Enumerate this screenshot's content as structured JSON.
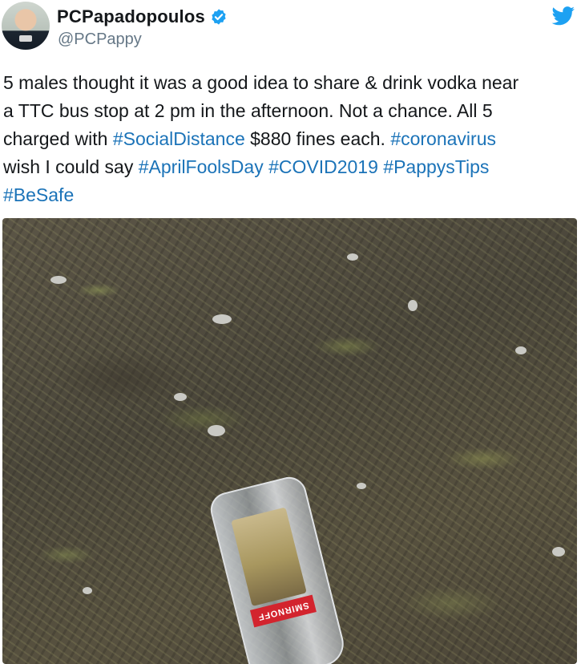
{
  "author": {
    "display_name": "PCPapadopoulos",
    "handle": "@PCPappy",
    "verified_icon": "verified-badge-icon",
    "accent_color": "#1da1f2"
  },
  "platform_icon": "twitter-bird-icon",
  "tweet": {
    "lines": [
      [
        {
          "t": "5 males thought it was a good idea to share & drink vodka near",
          "tag": false
        }
      ],
      [
        {
          "t": "a TTC bus stop at 2 pm in the afternoon. Not a chance. All 5",
          "tag": false
        }
      ],
      [
        {
          "t": "charged with ",
          "tag": false
        },
        {
          "t": "#SocialDistance",
          "tag": true
        },
        {
          "t": " $880 fines each. ",
          "tag": false
        },
        {
          "t": "#coronavirus",
          "tag": true
        }
      ],
      [
        {
          "t": " wish I could say ",
          "tag": false
        },
        {
          "t": "#AprilFoolsDay",
          "tag": true
        },
        {
          "t": " ",
          "tag": false
        },
        {
          "t": "#COVID2019",
          "tag": true
        },
        {
          "t": " ",
          "tag": false
        },
        {
          "t": "#PappysTips",
          "tag": true
        }
      ],
      [
        {
          "t": "#BeSafe",
          "tag": true
        }
      ]
    ],
    "hashtag_color": "#1b73b8"
  },
  "photo": {
    "bottle_brand": "SMIRNOFF"
  }
}
